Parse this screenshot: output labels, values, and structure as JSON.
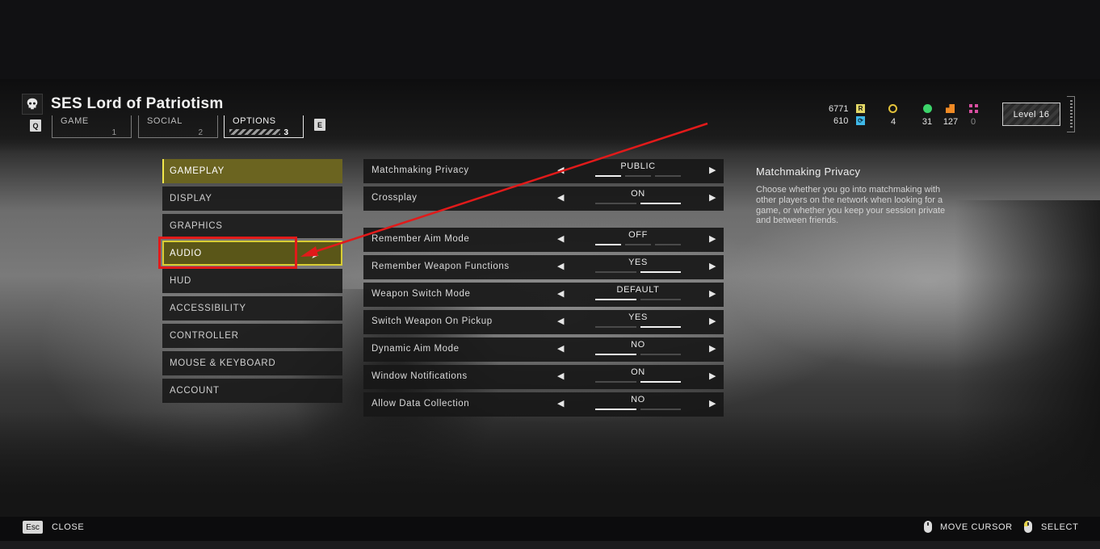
{
  "header": {
    "ship_name": "SES Lord of Patriotism",
    "prev_key": "Q",
    "next_key": "E",
    "tabs": [
      {
        "label": "GAME",
        "number": "1"
      },
      {
        "label": "SOCIAL",
        "number": "2"
      },
      {
        "label": "OPTIONS",
        "number": "3",
        "active": true
      }
    ]
  },
  "currencies": {
    "requisition": "6771",
    "requisition_icon": "R",
    "super_credits": "610",
    "medals": "4",
    "samples_common": "31",
    "samples_rare": "127",
    "samples_super": "0",
    "level": "Level 16",
    "colors": {
      "requisition": "#e3d866",
      "super_credits": "#3fb8e8",
      "medals": "#e3c23a",
      "samples_common": "#3cd46a",
      "samples_rare": "#f08a24",
      "samples_super": "#d94fa2"
    }
  },
  "categories": [
    {
      "label": "GAMEPLAY",
      "state": "selected"
    },
    {
      "label": "DISPLAY",
      "state": "normal"
    },
    {
      "label": "GRAPHICS",
      "state": "normal"
    },
    {
      "label": "AUDIO",
      "state": "hover"
    },
    {
      "label": "HUD",
      "state": "normal"
    },
    {
      "label": "ACCESSIBILITY",
      "state": "normal"
    },
    {
      "label": "CONTROLLER",
      "state": "normal"
    },
    {
      "label": "MOUSE & KEYBOARD",
      "state": "normal"
    },
    {
      "label": "ACCOUNT",
      "state": "normal"
    }
  ],
  "settings": [
    {
      "label": "Matchmaking Privacy",
      "value": "PUBLIC",
      "options": 3,
      "index": 0
    },
    {
      "label": "Crossplay",
      "value": "ON",
      "options": 2,
      "index": 1
    },
    {
      "label": "Remember Aim Mode",
      "value": "OFF",
      "options": 3,
      "index": 0
    },
    {
      "label": "Remember Weapon Functions",
      "value": "YES",
      "options": 2,
      "index": 1
    },
    {
      "label": "Weapon Switch Mode",
      "value": "DEFAULT",
      "options": 2,
      "index": 0
    },
    {
      "label": "Switch Weapon On Pickup",
      "value": "YES",
      "options": 2,
      "index": 1
    },
    {
      "label": "Dynamic Aim Mode",
      "value": "NO",
      "options": 2,
      "index": 0
    },
    {
      "label": "Window Notifications",
      "value": "ON",
      "options": 2,
      "index": 1
    },
    {
      "label": "Allow Data Collection",
      "value": "NO",
      "options": 2,
      "index": 0
    }
  ],
  "description": {
    "title": "Matchmaking Privacy",
    "body": "Choose whether you go into matchmaking with other players on the network when looking for a game, or whether you keep your session private and between friends."
  },
  "footer": {
    "close_key": "Esc",
    "close_label": "CLOSE",
    "move_cursor_label": "MOVE CURSOR",
    "select_label": "SELECT"
  },
  "annotation_color": "#e11a1a"
}
